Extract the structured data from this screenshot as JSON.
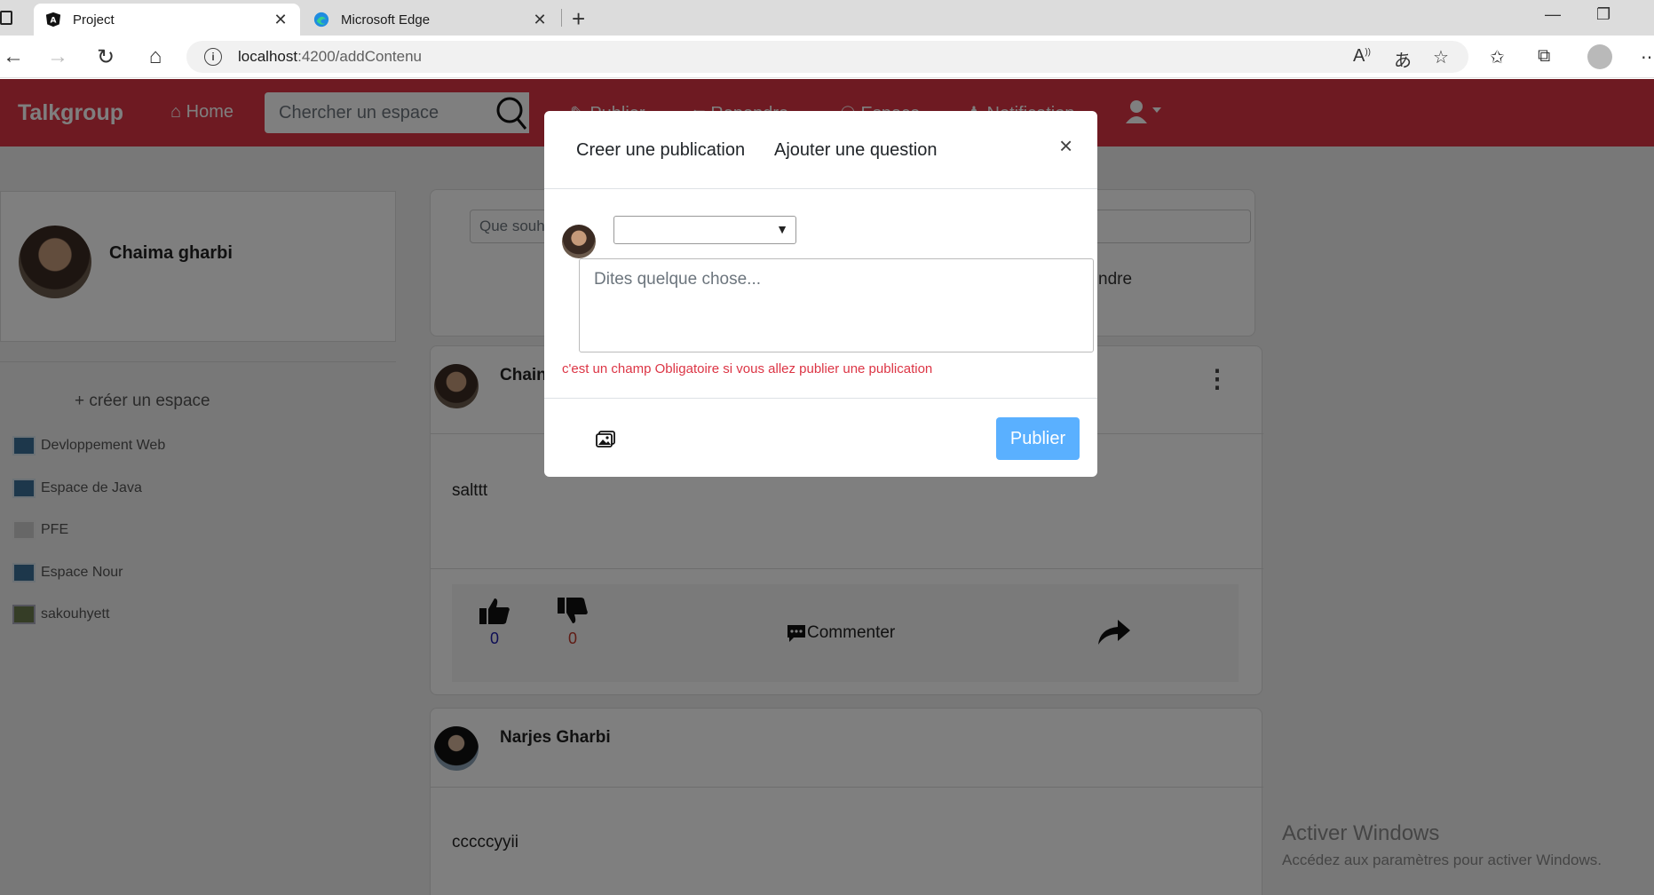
{
  "browser": {
    "tabs": [
      {
        "title": "Project",
        "active": true
      },
      {
        "title": "Microsoft Edge",
        "active": false
      }
    ],
    "url_host": "localhost",
    "url_path": ":4200/addContenu"
  },
  "navbar": {
    "brand": "Talkgroup",
    "home": "Home",
    "search_placeholder": "Chercher un espace",
    "items": [
      "Publier",
      "Repondre",
      "Espace",
      "Notification"
    ]
  },
  "sidebar": {
    "user_name": "Chaima gharbi",
    "create_space": "+ créer un espace",
    "spaces": [
      "Devloppement Web",
      "Espace de Java",
      "PFE",
      "Espace Nour",
      "sakouhyett"
    ]
  },
  "ask_card": {
    "placeholder": "Que souh",
    "right_text": "ndre"
  },
  "posts": [
    {
      "author": "Chain",
      "text": "salttt",
      "likes": "0",
      "dislikes": "0",
      "comment_label": "Commenter"
    },
    {
      "author": "Narjes Gharbi",
      "text": "cccccyyii"
    }
  ],
  "watermark": {
    "title": "Activer Windows",
    "subtitle": "Accédez aux paramètres pour activer Windows."
  },
  "modal": {
    "tab_publication": "Creer une publication",
    "tab_question": "Ajouter une question",
    "close": "×",
    "textarea_placeholder": "Dites quelque chose...",
    "error_message": "c'est un champ Obligatoire si vous allez publier une publication",
    "publish_button": "Publier"
  },
  "colors": {
    "navbar": "#dc3545",
    "publish_button": "#5ab0ff",
    "error": "#dc3545"
  }
}
